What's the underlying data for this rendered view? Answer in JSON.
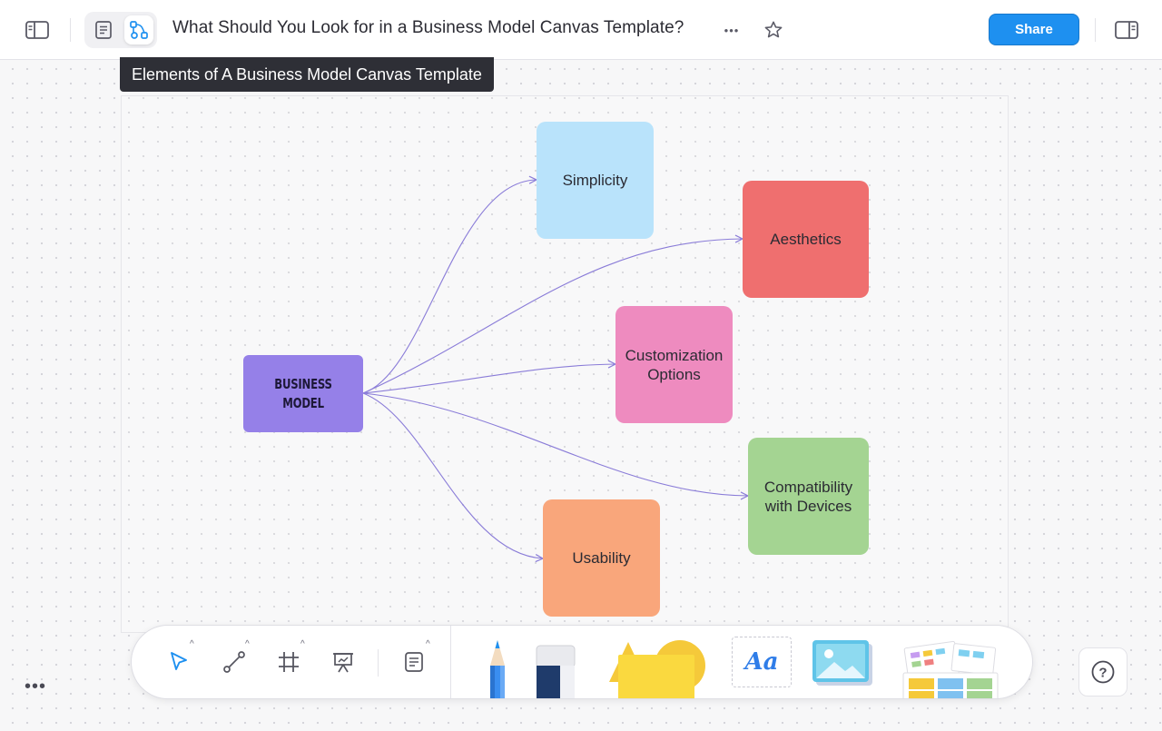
{
  "header": {
    "title": "What Should You Look for in a Business Model Canvas Template?",
    "share_label": "Share",
    "more_glyph": "•••"
  },
  "canvas": {
    "frame_title": "Elements of A Business Model Canvas Template",
    "nodes": {
      "center": {
        "label": "BUSINESS MODEL",
        "color": "#9580e8"
      },
      "simplicity": {
        "label": "Simplicity",
        "color": "#b9e3fb"
      },
      "aesthetics": {
        "label": "Aesthetics",
        "color": "#ef6f6f"
      },
      "customization": {
        "label": "Customization Options",
        "color": "#ee8bbf"
      },
      "compatibility": {
        "label": "Compatibility with Devices",
        "color": "#a4d492"
      },
      "usability": {
        "label": "Usability",
        "color": "#f9a67b"
      }
    },
    "connector_color": "#8a7cd8"
  },
  "toolbar": {
    "tools": [
      "select-tool",
      "connector-tool",
      "frame-tool",
      "presentation-tool",
      "sticky-note-tool"
    ],
    "assets": [
      "pencil-tool",
      "eraser-tool",
      "shapes-tool",
      "text-tool",
      "image-tool",
      "templates-tool"
    ],
    "text_tool_glyph": "Aa"
  },
  "footer": {
    "more_glyph": "•••",
    "help_glyph": "?"
  },
  "colors": {
    "accent": "#1e90f0",
    "dark_label": "#2e2f36"
  }
}
